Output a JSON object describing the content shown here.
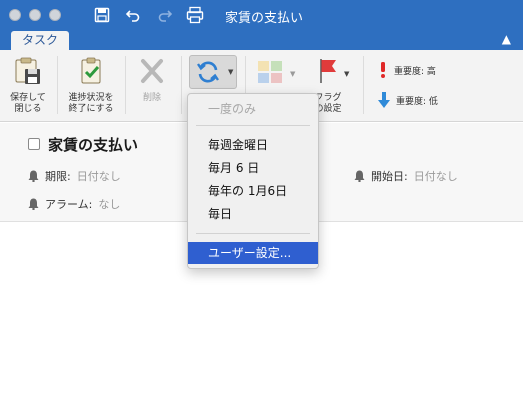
{
  "window": {
    "title": "家賃の支払い"
  },
  "ribbon": {
    "tab": "タスク",
    "save_close": [
      "保存して",
      "閉じる"
    ],
    "mark_complete": [
      "進捗状況を",
      "終了にする"
    ],
    "delete": "削除",
    "flag": [
      "フラグ",
      "の設定"
    ],
    "priority_high": "重要度: 高",
    "priority_low": "重要度: 低"
  },
  "task": {
    "title": "家賃の支払い",
    "due_label": "期限:",
    "due_value": "日付なし",
    "start_label": "開始日:",
    "start_value": "日付なし",
    "alarm_label": "アラーム:",
    "alarm_value": "なし"
  },
  "recurrence_menu": {
    "items": [
      "一度のみ",
      "毎週金曜日",
      "毎月 6 日",
      "毎年の 1月6日",
      "毎日"
    ],
    "custom": "ユーザー設定..."
  },
  "colors": {
    "accent": "#2e6fc0",
    "menu_selected": "#2f5fd0",
    "flag_red": "#e03b3b",
    "priority_high": "#e02828",
    "priority_low": "#2f8ad8"
  },
  "icons": [
    "close-window",
    "minimize-window",
    "zoom-window",
    "save-icon",
    "undo-icon",
    "redo-icon",
    "print-icon",
    "save-close-icon",
    "mark-complete-icon",
    "delete-icon",
    "recurrence-icon",
    "categorize-icon",
    "flag-icon",
    "priority-high-icon",
    "priority-low-icon",
    "bell-icon"
  ]
}
